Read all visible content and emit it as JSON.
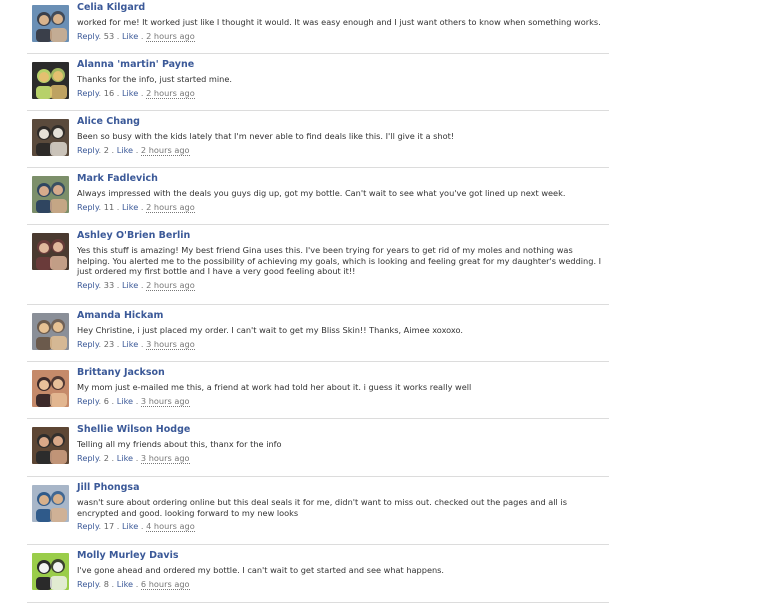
{
  "comments": [
    {
      "name": "Celia Kilgard",
      "text": "worked for me! It worked just like I thought it would. It was easy enough and I just want others to know when something works.",
      "reply": "Reply",
      "likes": "53",
      "like": "Like",
      "time": "2 hours ago",
      "avatar_colors": [
        "#6a8fb5",
        "#d9b38c",
        "#3a3f4a"
      ]
    },
    {
      "name": "Alanna 'martin' Payne",
      "text": "Thanks for the info, just started mine.",
      "reply": "Reply",
      "likes": "16",
      "like": "Like",
      "time": "2 hours ago",
      "avatar_colors": [
        "#2b2b2b",
        "#e4c070",
        "#b7d16a"
      ]
    },
    {
      "name": "Alice Chang",
      "text": "Been so busy with the kids lately that I'm never able to find deals like this. I'll give it a shot!",
      "reply": "Reply",
      "likes": "2",
      "like": "Like",
      "time": "2 hours ago",
      "avatar_colors": [
        "#5a4a3c",
        "#e6e1d8",
        "#2d2a28"
      ]
    },
    {
      "name": "Mark Fadlevich",
      "text": "Always impressed with the deals you guys dig up, got my bottle. Can't wait to see what you've got lined up next week.",
      "reply": "Reply",
      "likes": "11",
      "like": "Like",
      "time": "2 hours ago",
      "avatar_colors": [
        "#7c8f6a",
        "#d6ab8c",
        "#2f4560"
      ]
    },
    {
      "name": "Ashley O'Brien Berlin",
      "text": "Yes this stuff is amazing! My best friend Gina uses this. I've been trying for years to get rid of my moles and nothing was helping. You alerted me to the possibility of achieving my goals, which is looking and feeling great for my daughter's wedding. I just ordered my first bottle and I have a very good feeling about it!!",
      "reply": "Reply",
      "likes": "33",
      "like": "Like",
      "time": "2 hours ago",
      "avatar_colors": [
        "#4a3a30",
        "#e0b89c",
        "#6a3b3a"
      ]
    },
    {
      "name": "Amanda Hickam",
      "text": "Hey Christine, i just placed my order. I can't wait to get my Bliss Skin!! Thanks, Aimee xoxoxo.",
      "reply": "Reply",
      "likes": "23",
      "like": "Like",
      "time": "3 hours ago",
      "avatar_colors": [
        "#8a8f98",
        "#e7c294",
        "#6b5a4c"
      ]
    },
    {
      "name": "Brittany Jackson",
      "text": "My mom just e-mailed me this, a friend at work had told her about it. i guess it works really well",
      "reply": "Reply",
      "likes": "6",
      "like": "Like",
      "time": "3 hours ago",
      "avatar_colors": [
        "#c58a6a",
        "#e8c09a",
        "#3c2a2a"
      ]
    },
    {
      "name": "Shellie Wilson Hodge",
      "text": "Telling all my friends about this, thanx for the info",
      "reply": "Reply",
      "likes": "2",
      "like": "Like",
      "time": "3 hours ago",
      "avatar_colors": [
        "#5d4634",
        "#d9a888",
        "#2c2c2c"
      ]
    },
    {
      "name": "Jill Phongsa",
      "text": "wasn't sure about ordering online but this deal seals it for me, didn't want to miss out. checked out the pages and all is encrypted and good. looking forward to my new looks",
      "reply": "Reply",
      "likes": "17",
      "like": "Like",
      "time": "4 hours ago",
      "avatar_colors": [
        "#a8b6c8",
        "#d8b08a",
        "#2f5a8a"
      ]
    },
    {
      "name": "Molly Murley Davis",
      "text": "I've gone ahead and ordered my bottle. I can't wait to get started and see what happens.",
      "reply": "Reply",
      "likes": "8",
      "like": "Like",
      "time": "6 hours ago",
      "avatar_colors": [
        "#9acd4a",
        "#f2f2f2",
        "#2a2a2a"
      ]
    }
  ]
}
